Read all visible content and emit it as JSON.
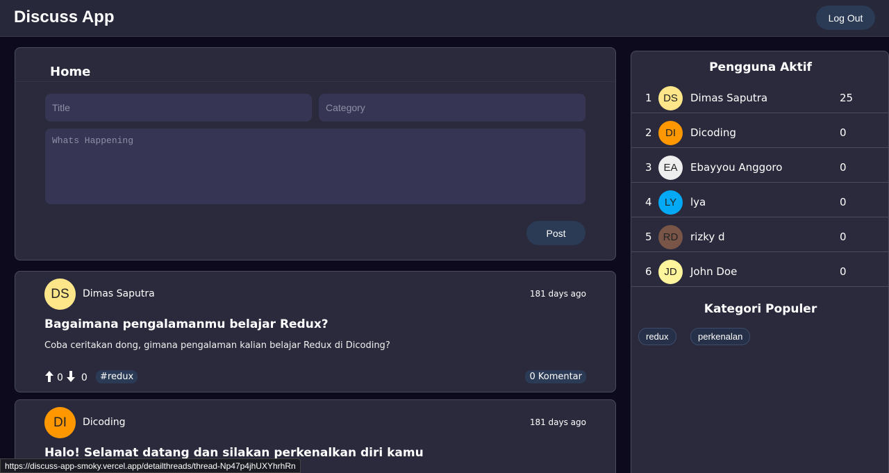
{
  "header": {
    "app_title": "Discuss App",
    "logout_label": "Log Out"
  },
  "composer": {
    "heading": "Home",
    "title_placeholder": "Title",
    "category_placeholder": "Category",
    "body_placeholder": "Whats Happening",
    "post_label": "Post"
  },
  "threads": [
    {
      "avatar_initials": "DS",
      "avatar_color": "#fde68a",
      "author": "Dimas Saputra",
      "time": "181 days ago",
      "title": "Bagaimana pengalamanmu belajar Redux?",
      "body": "Coba ceritakan dong, gimana pengalaman kalian belajar Redux di Dicoding?",
      "upvotes": "0",
      "downvotes": "0",
      "tag": "#redux",
      "comments": "0 Komentar"
    },
    {
      "avatar_initials": "DI",
      "avatar_color": "#ff9800",
      "author": "Dicoding",
      "time": "181 days ago",
      "title": "Halo! Selamat datang dan silakan perkenalkan diri kamu"
    }
  ],
  "leaderboard": {
    "title": "Pengguna Aktif",
    "users": [
      {
        "rank": "1",
        "initials": "DS",
        "color": "#fde68a",
        "name": "Dimas Saputra",
        "score": "25"
      },
      {
        "rank": "2",
        "initials": "DI",
        "color": "#ff9800",
        "name": "Dicoding",
        "score": "0"
      },
      {
        "rank": "3",
        "initials": "EA",
        "color": "#eeeeee",
        "name": "Ebayyou Anggoro",
        "score": "0"
      },
      {
        "rank": "4",
        "initials": "LY",
        "color": "#03a9f4",
        "name": "lya",
        "score": "0"
      },
      {
        "rank": "5",
        "initials": "RD",
        "color": "#795548",
        "name": "rizky d",
        "score": "0"
      },
      {
        "rank": "6",
        "initials": "JD",
        "color": "#fff59d",
        "name": "John Doe",
        "score": "0"
      }
    ]
  },
  "categories": {
    "title": "Kategori Populer",
    "items": [
      "redux",
      "perkenalan"
    ]
  },
  "status_bar": {
    "url": "https://discuss-app-smoky.vercel.app/detailthreads/thread-Np47p4jhUXYhrhRn"
  },
  "colors": {
    "background": "#0d0a1e",
    "card": "#2a2a3c",
    "accent_button": "#2b3a55",
    "input": "#363654"
  }
}
